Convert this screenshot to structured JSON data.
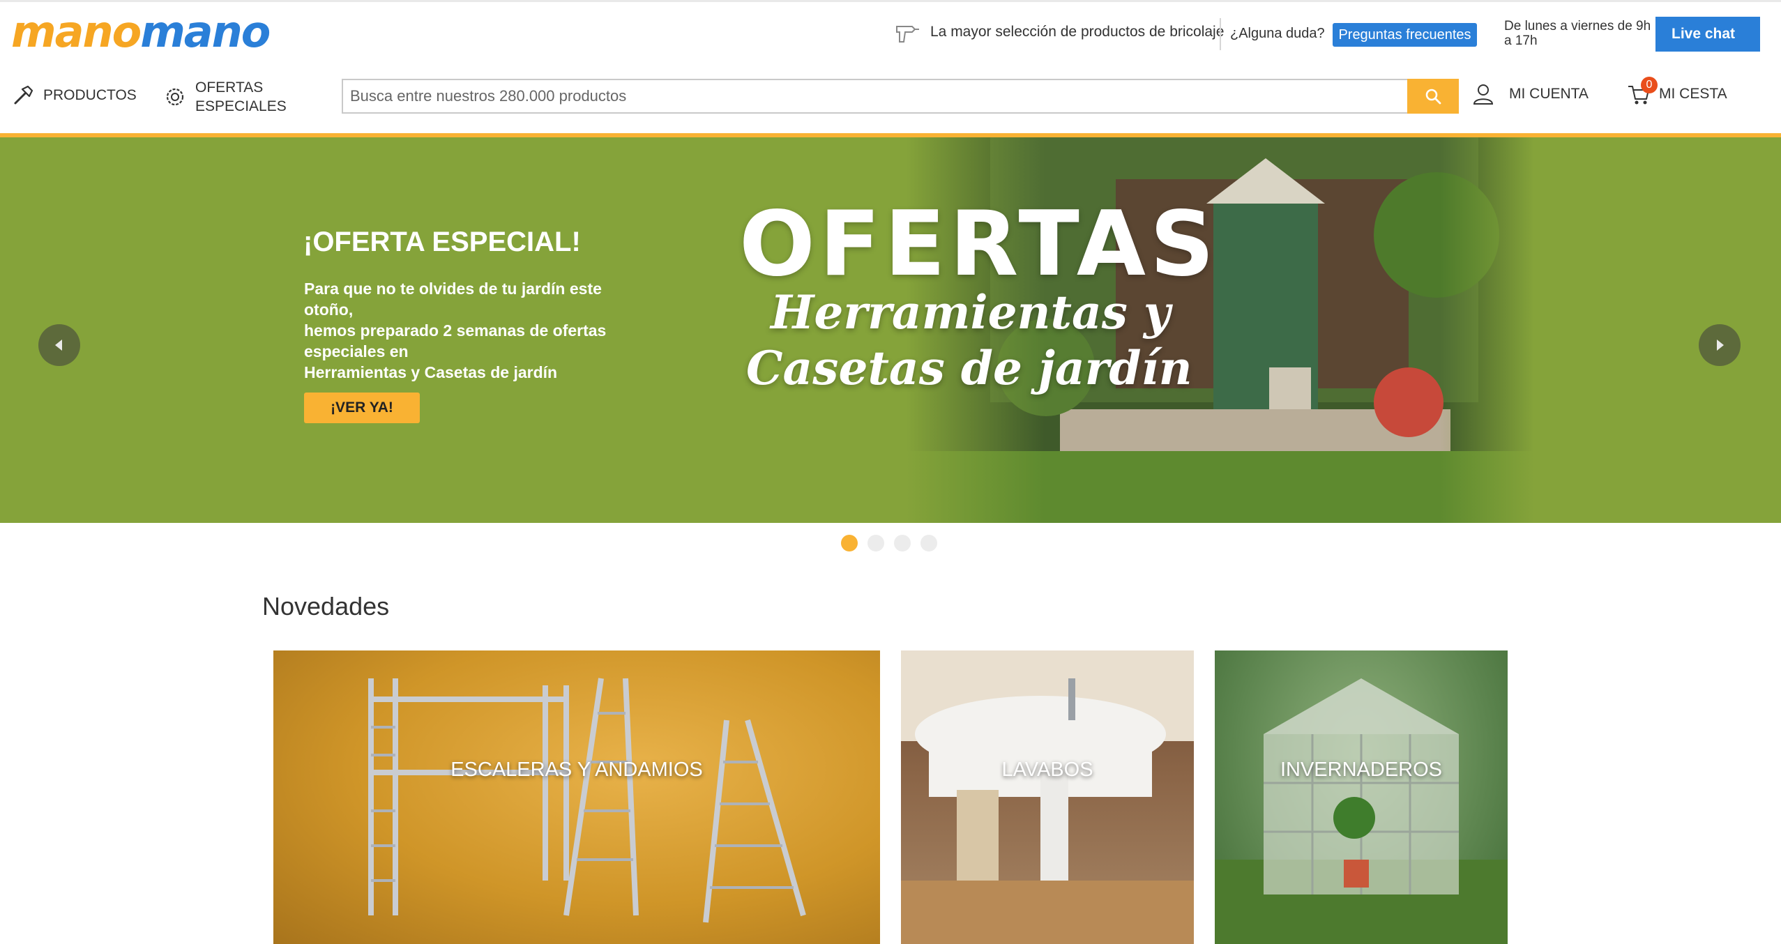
{
  "header": {
    "logo": {
      "part1": "mano",
      "part2": "mano"
    },
    "tagline": "La mayor selección de productos de bricolaje",
    "question": "¿Alguna duda?",
    "faq_label": "Preguntas frecuentes",
    "hours": "De lunes a viernes de 9h a 17h",
    "live_chat_label": "Live chat"
  },
  "nav": {
    "productos": "PRODUCTOS",
    "ofertas": "OFERTAS ESPECIALES",
    "search_placeholder": "Busca entre nuestros 280.000 productos",
    "account": "MI CUENTA",
    "cart": "MI CESTA",
    "cart_count": "0"
  },
  "hero": {
    "title": "¡OFERTA ESPECIAL!",
    "text_line1": "Para que no te olvides de tu jardín este otoño,",
    "text_line2": "hemos preparado 2 semanas de ofertas especiales en",
    "text_line3": "Herramientas y Casetas de jardín",
    "cta": "¡VER YA!",
    "big_title": "OFERTAS",
    "script_line1": "Herramientas y",
    "script_line2": "Casetas de jardín",
    "slide_count": 4,
    "active_slide": 1
  },
  "novedades": {
    "title": "Novedades",
    "tiles": [
      {
        "label": "ESCALERAS Y ANDAMIOS"
      },
      {
        "label": "LAVABOS"
      },
      {
        "label": "INVERNADEROS"
      }
    ]
  },
  "colors": {
    "brand_orange": "#f9b233",
    "brand_blue": "#2a7fd8",
    "hero_green": "#85a33a",
    "badge_red": "#e94e1b"
  }
}
